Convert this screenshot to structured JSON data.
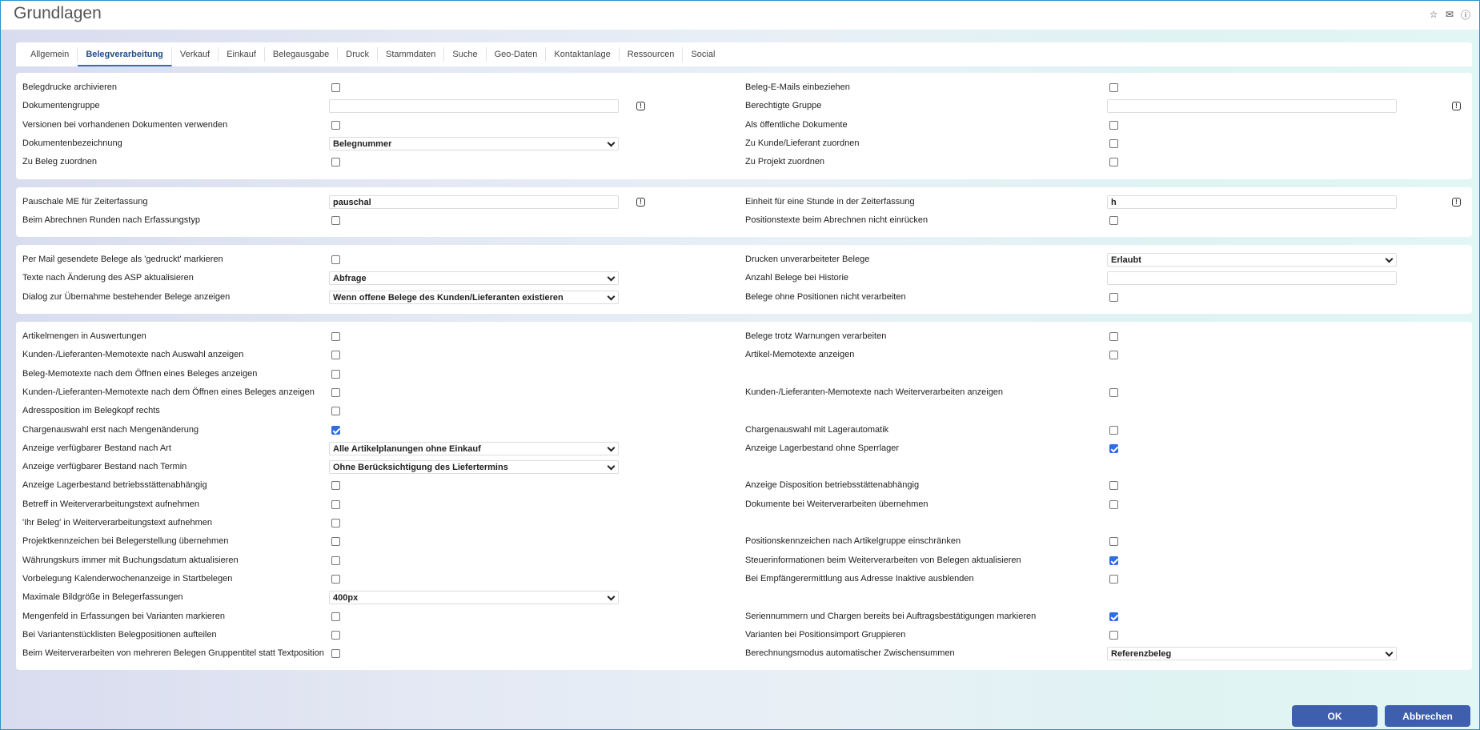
{
  "window": {
    "title": "Grundlagen"
  },
  "tabs": [
    "Allgemein",
    "Belegverarbeitung",
    "Verkauf",
    "Einkauf",
    "Belegausgabe",
    "Druck",
    "Stammdaten",
    "Suche",
    "Geo-Daten",
    "Kontaktanlage",
    "Ressourcen",
    "Social"
  ],
  "active_tab": "Belegverarbeitung",
  "sections": [
    {
      "rows": [
        {
          "l": {
            "label": "Belegdrucke archivieren",
            "type": "checkbox",
            "checked": false
          },
          "r": {
            "label": "Beleg-E-Mails einbeziehen",
            "type": "checkbox",
            "checked": false
          }
        },
        {
          "l": {
            "label": "Dokumentengruppe",
            "type": "input",
            "value": "",
            "info": true
          },
          "r": {
            "label": "Berechtigte Gruppe",
            "type": "input",
            "value": "",
            "info": true
          }
        },
        {
          "l": {
            "label": "Versionen bei vorhandenen Dokumenten verwenden",
            "type": "checkbox",
            "checked": false
          },
          "r": {
            "label": "Als öffentliche Dokumente",
            "type": "checkbox",
            "checked": false
          }
        },
        {
          "l": {
            "label": "Dokumentenbezeichnung",
            "type": "select",
            "value": "Belegnummer"
          },
          "r": {
            "label": "Zu Kunde/Lieferant zuordnen",
            "type": "checkbox",
            "checked": false
          }
        },
        {
          "l": {
            "label": "Zu Beleg zuordnen",
            "type": "checkbox",
            "checked": false
          },
          "r": {
            "label": "Zu Projekt zuordnen",
            "type": "checkbox",
            "checked": false
          }
        }
      ]
    },
    {
      "rows": [
        {
          "l": {
            "label": "Pauschale ME für Zeiterfassung",
            "type": "input",
            "value": "pauschal",
            "info": true
          },
          "r": {
            "label": "Einheit für eine Stunde in der Zeiterfassung",
            "type": "input",
            "value": "h",
            "info": true
          }
        },
        {
          "l": {
            "label": "Beim Abrechnen Runden nach Erfassungstyp",
            "type": "checkbox",
            "checked": false
          },
          "r": {
            "label": "Positionstexte beim Abrechnen nicht einrücken",
            "type": "checkbox",
            "checked": false
          }
        }
      ]
    },
    {
      "rows": [
        {
          "l": {
            "label": "Per Mail gesendete Belege als 'gedruckt' markieren",
            "type": "checkbox",
            "checked": false
          },
          "r": {
            "label": "Drucken unverarbeiteter Belege",
            "type": "select",
            "value": "Erlaubt"
          }
        },
        {
          "l": {
            "label": "Texte nach Änderung des ASP aktualisieren",
            "type": "select",
            "value": "Abfrage"
          },
          "r": {
            "label": "Anzahl Belege bei Historie",
            "type": "input",
            "value": ""
          }
        },
        {
          "l": {
            "label": "Dialog zur Übernahme bestehender Belege anzeigen",
            "type": "select",
            "value": "Wenn offene Belege des Kunden/Lieferanten existieren"
          },
          "r": {
            "label": "Belege ohne Positionen nicht verarbeiten",
            "type": "checkbox",
            "checked": false
          }
        }
      ]
    },
    {
      "rows": [
        {
          "l": {
            "label": "Artikelmengen in Auswertungen",
            "type": "checkbox",
            "checked": false
          },
          "r": {
            "label": "Belege trotz Warnungen verarbeiten",
            "type": "checkbox",
            "checked": false
          }
        },
        {
          "l": {
            "label": "Kunden-/Lieferanten-Memotexte nach Auswahl anzeigen",
            "type": "checkbox",
            "checked": false
          },
          "r": {
            "label": "Artikel-Memotexte anzeigen",
            "type": "checkbox",
            "checked": false
          }
        },
        {
          "l": {
            "label": "Beleg-Memotexte nach dem Öffnen eines Beleges anzeigen",
            "type": "checkbox",
            "checked": false
          },
          "r": null
        },
        {
          "l": {
            "label": "Kunden-/Lieferanten-Memotexte nach dem Öffnen eines Beleges anzeigen",
            "type": "checkbox",
            "checked": false
          },
          "r": {
            "label": "Kunden-/Lieferanten-Memotexte nach Weiterverarbeiten anzeigen",
            "type": "checkbox",
            "checked": false
          }
        },
        {
          "l": {
            "label": "Adressposition im Belegkopf rechts",
            "type": "checkbox",
            "checked": false
          },
          "r": null
        },
        {
          "l": {
            "label": "Chargenauswahl erst nach Mengenänderung",
            "type": "checkbox",
            "checked": true
          },
          "r": {
            "label": "Chargenauswahl mit Lagerautomatik",
            "type": "checkbox",
            "checked": false
          }
        },
        {
          "l": {
            "label": "Anzeige verfügbarer Bestand nach Art",
            "type": "select",
            "value": "Alle Artikelplanungen ohne Einkauf"
          },
          "r": {
            "label": "Anzeige Lagerbestand ohne Sperrlager",
            "type": "checkbox",
            "checked": true
          }
        },
        {
          "l": {
            "label": "Anzeige verfügbarer Bestand nach Termin",
            "type": "select",
            "value": "Ohne Berücksichtigung des Liefertermins"
          },
          "r": null
        },
        {
          "l": {
            "label": "Anzeige Lagerbestand betriebsstättenabhängig",
            "type": "checkbox",
            "checked": false
          },
          "r": {
            "label": "Anzeige Disposition betriebsstättenabhängig",
            "type": "checkbox",
            "checked": false
          }
        },
        {
          "l": {
            "label": "Betreff in Weiterverarbeitungstext aufnehmen",
            "type": "checkbox",
            "checked": false
          },
          "r": {
            "label": "Dokumente bei Weiterverarbeiten übernehmen",
            "type": "checkbox",
            "checked": false
          }
        },
        {
          "l": {
            "label": "'Ihr Beleg' in Weiterverarbeitungstext aufnehmen",
            "type": "checkbox",
            "checked": false
          },
          "r": null
        },
        {
          "l": {
            "label": "Projektkennzeichen bei Belegerstellung übernehmen",
            "type": "checkbox",
            "checked": false
          },
          "r": {
            "label": "Positionskennzeichen nach Artikelgruppe einschränken",
            "type": "checkbox",
            "checked": false
          }
        },
        {
          "l": {
            "label": "Währungskurs immer mit Buchungsdatum aktualisieren",
            "type": "checkbox",
            "checked": false
          },
          "r": {
            "label": "Steuerinformationen beim Weiterverarbeiten von Belegen aktualisieren",
            "type": "checkbox",
            "checked": true
          }
        },
        {
          "l": {
            "label": "Vorbelegung Kalenderwochenanzeige in Startbelegen",
            "type": "checkbox",
            "checked": false
          },
          "r": {
            "label": "Bei Empfängerermittlung aus Adresse Inaktive ausblenden",
            "type": "checkbox",
            "checked": false
          }
        },
        {
          "l": {
            "label": "Maximale Bildgröße in Belegerfassungen",
            "type": "select",
            "value": "400px"
          },
          "r": null
        },
        {
          "l": {
            "label": "Mengenfeld in Erfassungen bei Varianten markieren",
            "type": "checkbox",
            "checked": false
          },
          "r": {
            "label": "Seriennummern und Chargen bereits bei Auftragsbestätigungen markieren",
            "type": "checkbox",
            "checked": true
          }
        },
        {
          "l": {
            "label": "Bei Variantenstücklisten Belegpositionen aufteilen",
            "type": "checkbox",
            "checked": false
          },
          "r": {
            "label": "Varianten bei Positionsimport Gruppieren",
            "type": "checkbox",
            "checked": false
          }
        },
        {
          "l": {
            "label": "Beim Weiterverarbeiten von mehreren Belegen Gruppentitel statt Textposition",
            "type": "checkbox",
            "checked": false
          },
          "r": {
            "label": "Berechnungsmodus automatischer Zwischensummen",
            "type": "select",
            "value": "Referenzbeleg"
          }
        }
      ]
    }
  ],
  "buttons": {
    "ok": "OK",
    "cancel": "Abbrechen"
  },
  "icons": {
    "favorite": "star-icon",
    "mail": "mail-icon",
    "help": "help-icon"
  },
  "colors": {
    "accent": "#3d5fad",
    "checkbox_on": "#2f6de0",
    "tab_active": "#1f4e8c"
  }
}
